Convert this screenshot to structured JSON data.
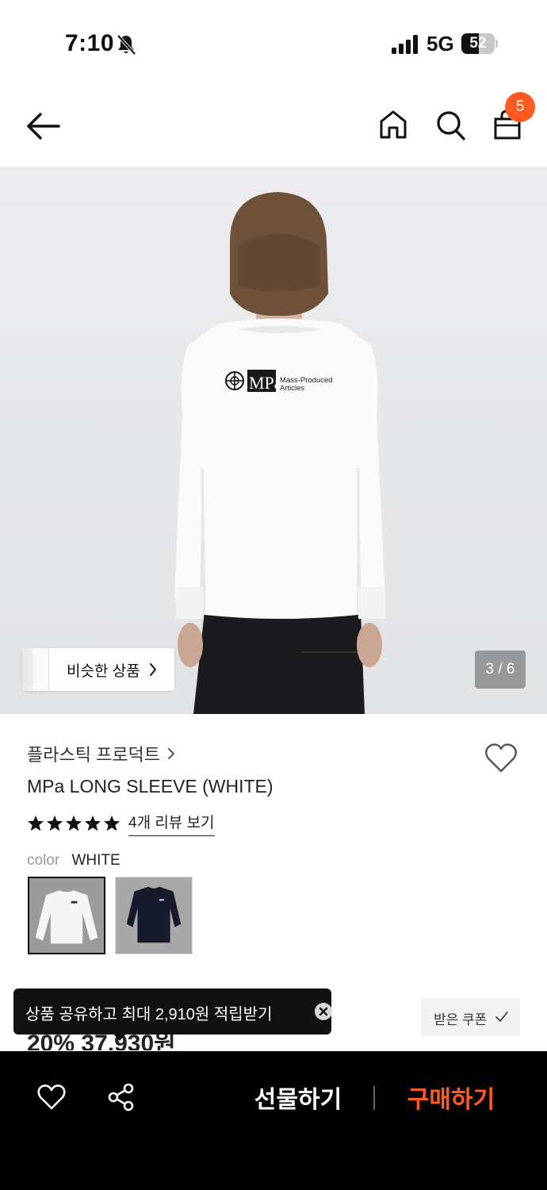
{
  "status_bar": {
    "time": "7:10",
    "network": "5G",
    "battery_level": "52",
    "battery_fraction": 0.52,
    "icons": [
      "bell-slash-icon",
      "signal-icon",
      "battery-icon"
    ]
  },
  "header": {
    "icons": [
      "back-arrow-icon",
      "home-icon",
      "search-icon",
      "shopping-bag-icon"
    ],
    "cart_count": "5",
    "accent_color": "#ff5a1f"
  },
  "gallery": {
    "similar_label": "비슷한 상품",
    "page_counter": "3 / 6",
    "print_brand": "MPa",
    "print_line1": "Mass-Produced",
    "print_line2": "Articles"
  },
  "product": {
    "brand": "플라스틱 프로덕트",
    "title": "MPa LONG SLEEVE (WHITE)",
    "rating": 5,
    "review_link": "4개 리뷰 보기",
    "color_key": "color",
    "color_value": "WHITE",
    "swatches": [
      "white-shirt-swatch",
      "navy-shirt-swatch"
    ],
    "price_partial": "20% 37,930원"
  },
  "toast": {
    "text": "상품 공유하고 최대 2,910원 적립받기"
  },
  "coupon": {
    "label": "받은 쿠폰"
  },
  "bottom_bar": {
    "gift_label": "선물하기",
    "buy_label": "구매하기",
    "buy_color": "#ff5a1f"
  }
}
